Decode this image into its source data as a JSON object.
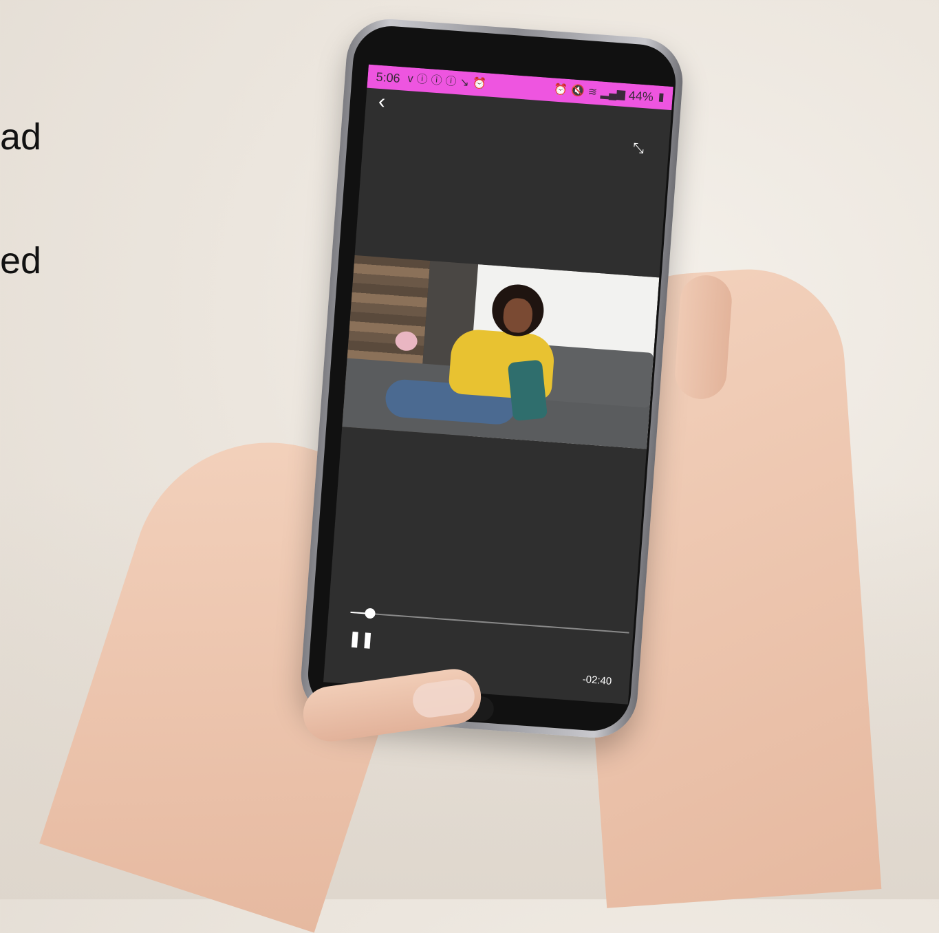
{
  "slide": {
    "lines": [
      "ad",
      "ed"
    ]
  },
  "statusbar": {
    "time": "5:06",
    "battery": "44%",
    "color": "#ee55e0",
    "left_icons": [
      "vimeo-icon",
      "info-icon",
      "info-icon",
      "info-icon",
      "missed-call-icon",
      "alarm-icon"
    ],
    "right_icons": [
      "alarm-icon",
      "mute-icon",
      "wifi-call-icon",
      "signal-icon",
      "battery-icon"
    ]
  },
  "player": {
    "back_icon": "chevron-left-icon",
    "fullscreen_icon": "expand-icon",
    "pause_icon": "pause-icon",
    "time_remaining": "-02:40",
    "progress": 0.07
  }
}
